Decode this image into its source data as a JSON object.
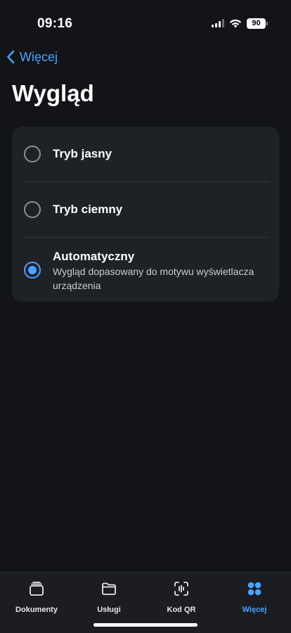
{
  "status_bar": {
    "time": "09:16",
    "battery": "90"
  },
  "nav": {
    "back_label": "Więcej"
  },
  "page": {
    "title": "Wygląd"
  },
  "options": [
    {
      "label": "Tryb jasny",
      "description": "",
      "selected": false
    },
    {
      "label": "Tryb ciemny",
      "description": "",
      "selected": false
    },
    {
      "label": "Automatyczny",
      "description": "Wygląd dopasowany do motywu wyświetlacza urządzenia",
      "selected": true
    }
  ],
  "tab_bar": {
    "items": [
      {
        "label": "Dokumenty",
        "icon": "documents-icon",
        "active": false
      },
      {
        "label": "Usługi",
        "icon": "folder-icon",
        "active": false
      },
      {
        "label": "Kod QR",
        "icon": "qr-scan-icon",
        "active": false
      },
      {
        "label": "Więcej",
        "icon": "more-grid-icon",
        "active": true
      }
    ]
  },
  "colors": {
    "background": "#121418",
    "card": "#1e2126",
    "accent": "#4aa3ff",
    "tab_bar": "#1b1d22"
  }
}
